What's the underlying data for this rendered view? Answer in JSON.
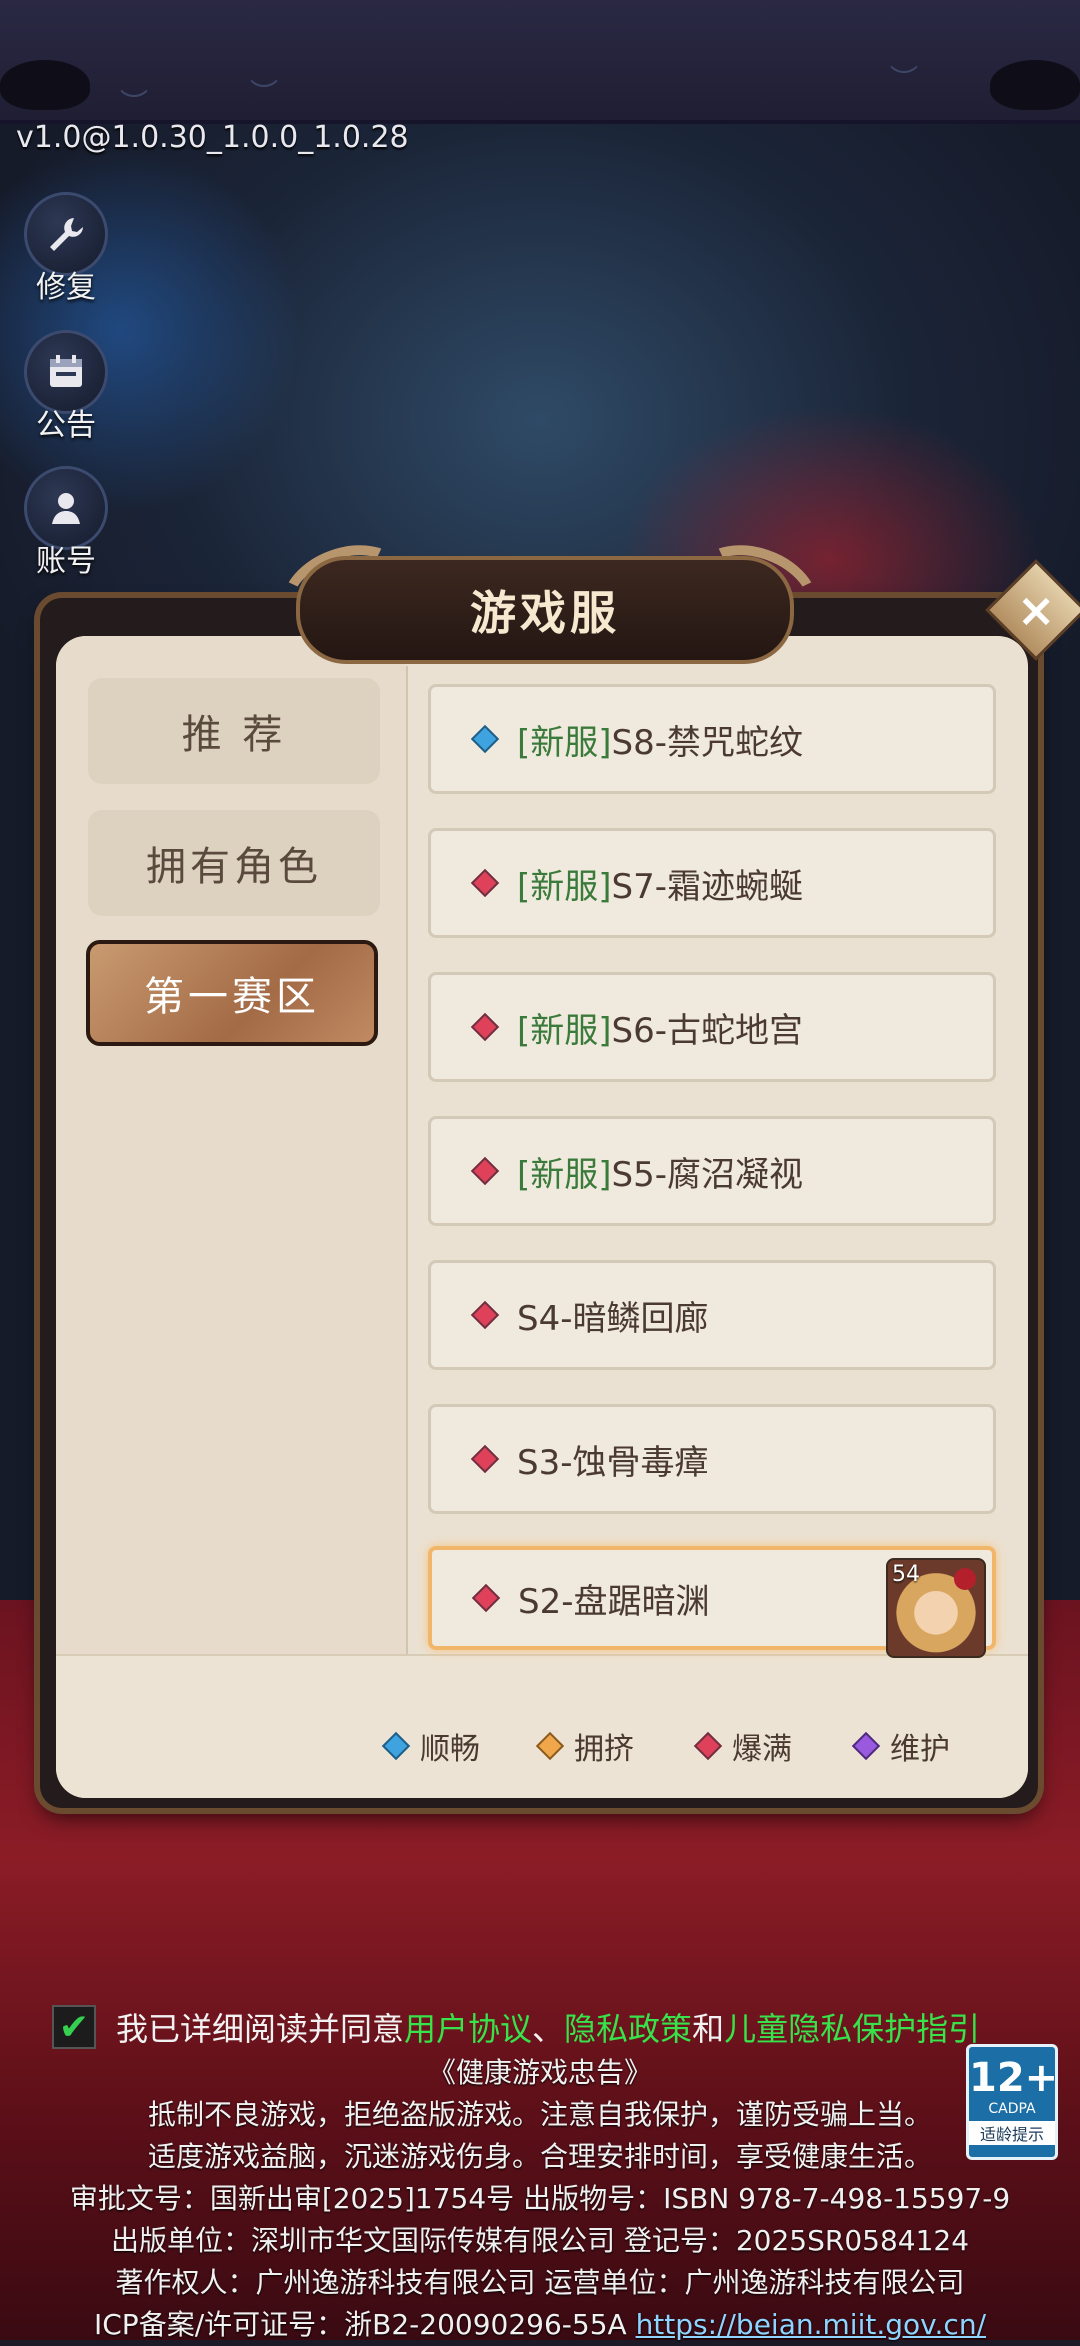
{
  "version": "v1.0@1.0.30_1.0.0_1.0.28",
  "side_buttons": [
    {
      "label": "修复",
      "icon": "wrench-icon"
    },
    {
      "label": "公告",
      "icon": "calendar-icon"
    },
    {
      "label": "账号",
      "icon": "account-icon"
    }
  ],
  "panel": {
    "title": "游戏服",
    "close_icon": "close-icon",
    "tabs": [
      {
        "label": "推 荐",
        "active": false
      },
      {
        "label": "拥有角色",
        "active": false
      },
      {
        "label": "第一赛区",
        "active": true
      }
    ],
    "servers": [
      {
        "tag": "[新服]",
        "name": "S8-禁咒蛇纹",
        "status": "smooth",
        "color": "#3fa3e0"
      },
      {
        "tag": "[新服]",
        "name": "S7-霜迹蜿蜒",
        "status": "full",
        "color": "#e0415a"
      },
      {
        "tag": "[新服]",
        "name": "S6-古蛇地宫",
        "status": "full",
        "color": "#e0415a"
      },
      {
        "tag": "[新服]",
        "name": "S5-腐沼凝视",
        "status": "full",
        "color": "#e0415a"
      },
      {
        "tag": "",
        "name": "S4-暗鳞回廊",
        "status": "full",
        "color": "#e0415a"
      },
      {
        "tag": "",
        "name": "S3-蚀骨毒瘴",
        "status": "full",
        "color": "#e0415a"
      },
      {
        "tag": "",
        "name": "S2-盘踞暗渊",
        "status": "full",
        "color": "#e0415a",
        "selected": true,
        "character_level": "54"
      }
    ],
    "legend": [
      {
        "label": "顺畅",
        "color": "#3fa3e0"
      },
      {
        "label": "拥挤",
        "color": "#f0a64a"
      },
      {
        "label": "爆满",
        "color": "#e0415a"
      },
      {
        "label": "维护",
        "color": "#9a5ae0"
      }
    ]
  },
  "agreement": {
    "prefix": "我已详细阅读并同意",
    "user_agreement": "用户协议",
    "sep1": "、",
    "privacy": "隐私政策",
    "and": "和",
    "child_privacy": "儿童隐私保护指引",
    "checked": true
  },
  "footer": {
    "line1": "《健康游戏忠告》",
    "line2": "抵制不良游戏，拒绝盗版游戏。注意自我保护，谨防受骗上当。",
    "line3": "适度游戏益脑，沉迷游戏伤身。合理安排时间，享受健康生活。",
    "line4": "审批文号：国新出审[2025]1754号 出版物号：ISBN 978-7-498-15597-9",
    "line5": "出版单位：深圳市华文国际传媒有限公司 登记号：2025SR0584124",
    "line6": "著作权人：广州逸游科技有限公司 运营单位：广州逸游科技有限公司",
    "line7_prefix": "ICP备案/许可证号：浙B2-20090296-55A ",
    "line7_url": "https://beian.miit.gov.cn/"
  },
  "age_rating": {
    "age": "12+",
    "org": "CADPA",
    "label": "适龄提示"
  }
}
